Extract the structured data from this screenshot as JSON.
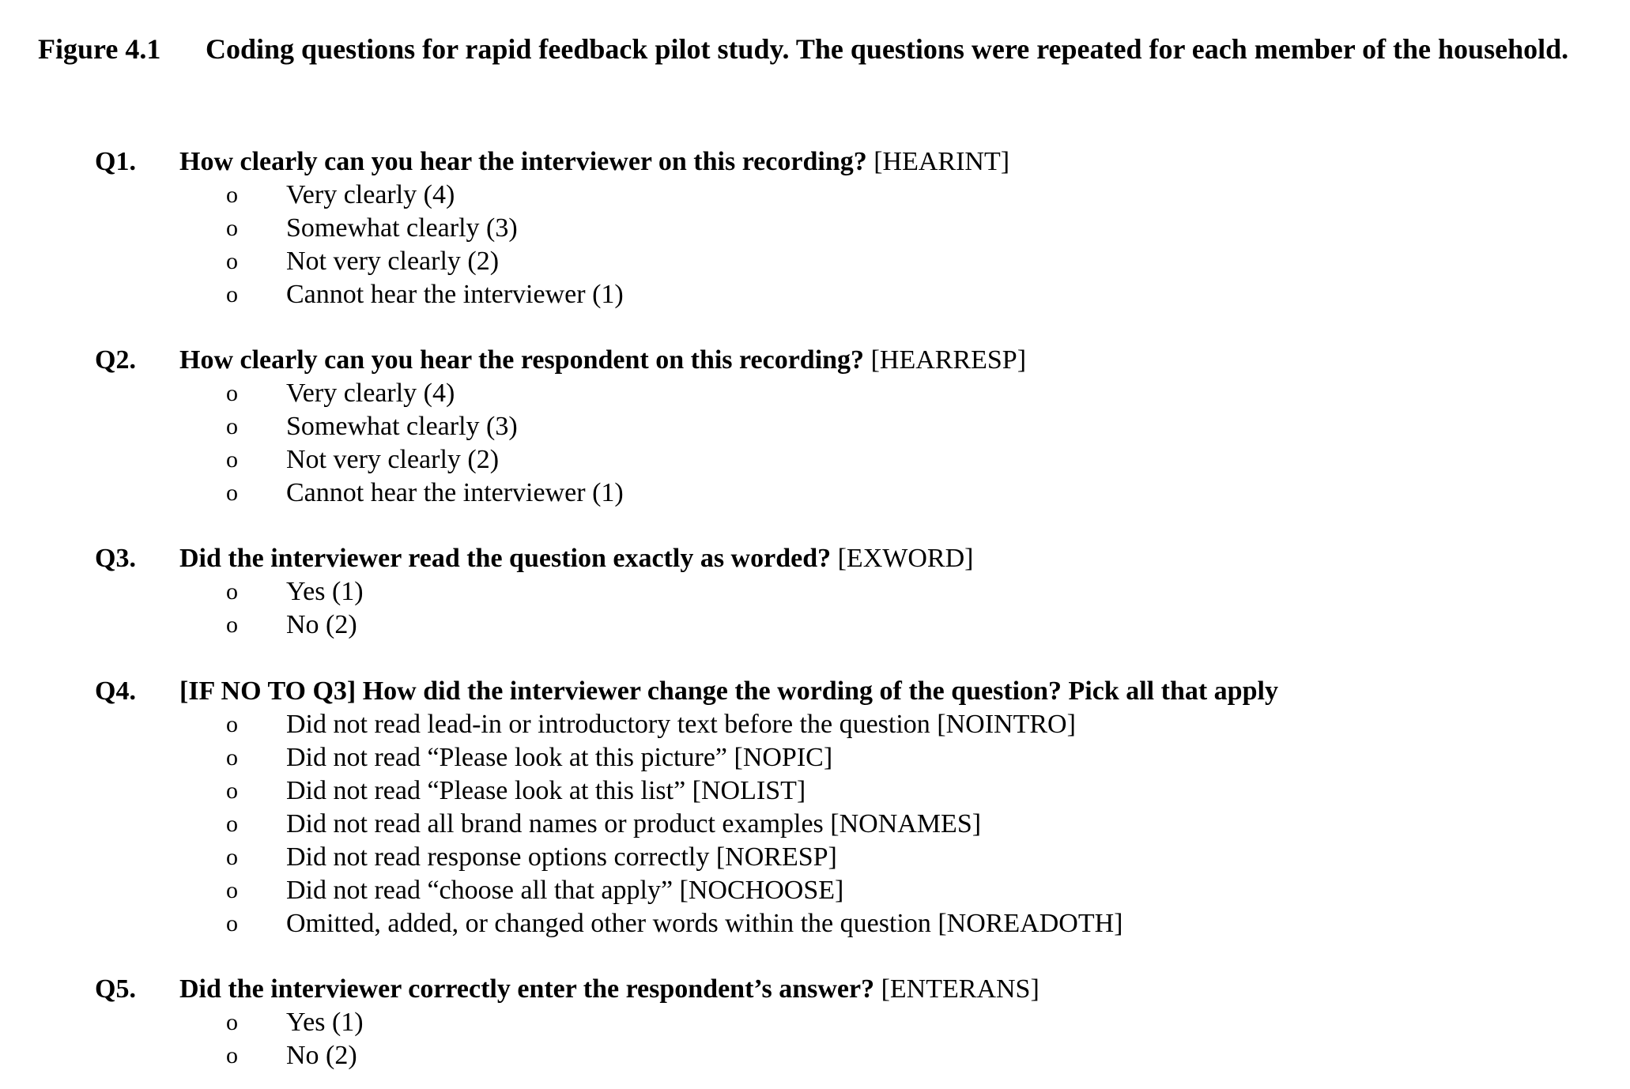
{
  "caption": {
    "label": "Figure 4.1",
    "text": "Coding questions for rapid feedback pilot study. The questions were repeated for each member of the household."
  },
  "bullet_glyph": "o",
  "questions": [
    {
      "number": "Q1.",
      "text": "How clearly can you hear the interviewer on this recording?",
      "code": "[HEARINT]",
      "options": [
        "Very clearly (4)",
        "Somewhat clearly (3)",
        "Not very clearly (2)",
        "Cannot hear the interviewer (1)"
      ]
    },
    {
      "number": "Q2.",
      "text": "How clearly can you hear the respondent on this recording?",
      "code": "[HEARRESP]",
      "options": [
        "Very clearly (4)",
        "Somewhat clearly (3)",
        "Not very clearly (2)",
        "Cannot hear the interviewer (1)"
      ]
    },
    {
      "number": "Q3.",
      "text": "Did the interviewer read the question exactly as worded?",
      "code": "[EXWORD]",
      "options": [
        "Yes (1)",
        "No (2)"
      ]
    },
    {
      "number": "Q4.",
      "text": "[IF NO TO Q3] How did the interviewer change the wording of the question? Pick all that apply",
      "code": "",
      "options": [
        "Did not read lead-in or introductory text before the question [NOINTRO]",
        "Did not read “Please look at this picture” [NOPIC]",
        "Did not read “Please look at this list” [NOLIST]",
        "Did not read all brand names or product examples [NONAMES]",
        "Did not read response options correctly [NORESP]",
        "Did not read “choose all that apply” [NOCHOOSE]",
        "Omitted, added, or changed other words within the question [NOREADOTH]"
      ]
    },
    {
      "number": "Q5.",
      "text": "Did the interviewer correctly enter the respondent’s answer?",
      "code": "[ENTERANS]",
      "options": [
        "Yes (1)",
        "No (2)"
      ]
    }
  ]
}
